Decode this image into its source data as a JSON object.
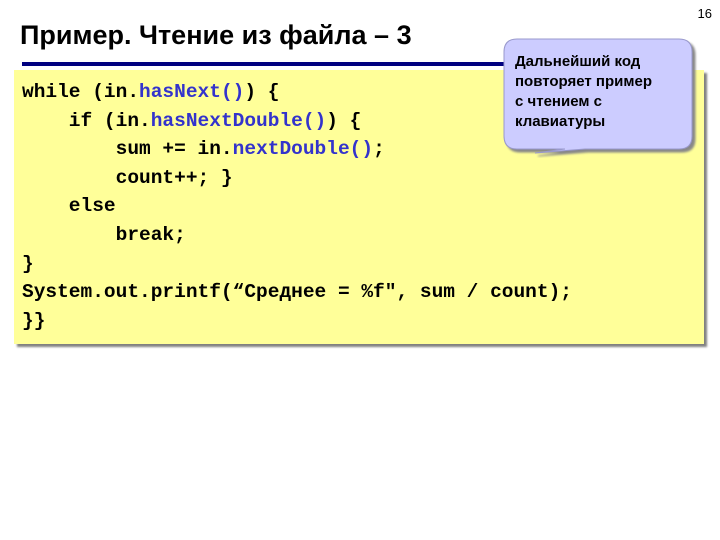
{
  "slide": {
    "number": "16",
    "title": "Пример. Чтение из файла – 3"
  },
  "code": {
    "lines": [
      {
        "segments": [
          {
            "t": "while (in.",
            "c": "k"
          },
          {
            "t": "hasNext()",
            "c": "b"
          },
          {
            "t": ") {",
            "c": "k"
          }
        ]
      },
      {
        "segments": [
          {
            "t": "    if (in.",
            "c": "k"
          },
          {
            "t": "hasNextDouble()",
            "c": "b"
          },
          {
            "t": ") {",
            "c": "k"
          }
        ]
      },
      {
        "segments": [
          {
            "t": "        sum += in.",
            "c": "k"
          },
          {
            "t": "nextDouble()",
            "c": "b"
          },
          {
            "t": ";",
            "c": "k"
          }
        ]
      },
      {
        "segments": [
          {
            "t": "        count++; }",
            "c": "k"
          }
        ]
      },
      {
        "segments": [
          {
            "t": "    else",
            "c": "k"
          }
        ]
      },
      {
        "segments": [
          {
            "t": "        break;",
            "c": "k"
          }
        ]
      },
      {
        "segments": [
          {
            "t": "}",
            "c": "k"
          }
        ]
      },
      {
        "segments": [
          {
            "t": "System.out.printf(“Среднее = %f\", sum / count);",
            "c": "k"
          }
        ]
      },
      {
        "segments": [
          {
            "t": "}}",
            "c": "k"
          }
        ]
      }
    ]
  },
  "callout": {
    "text_lines": [
      "Дальнейший код",
      "повторяет пример",
      "с чтением с",
      "клавиатуры"
    ]
  },
  "colors": {
    "code_background": "#ffff99",
    "method_highlight": "#3333cc",
    "callout_fill": "#ccccff",
    "title_rule": "#000080"
  }
}
